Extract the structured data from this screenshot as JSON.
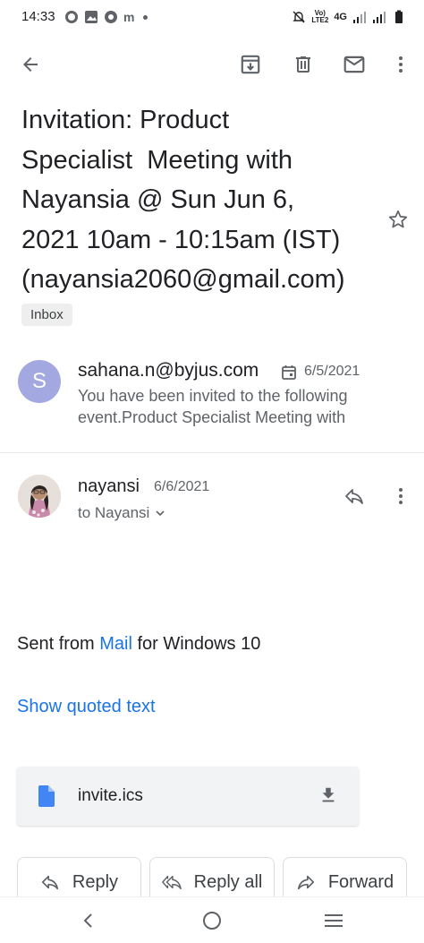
{
  "status_bar": {
    "time": "14:33",
    "left_icons": [
      "whatsapp-icon",
      "gallery-icon",
      "chrome-icon",
      "messenger-icon",
      "dot-icon"
    ],
    "network_label_top": "Vo)",
    "network_label_bottom": "LTE2",
    "network_type": "4G",
    "right_icons": [
      "mute-icon",
      "signal-icon",
      "signal-icon",
      "battery-icon"
    ]
  },
  "toolbar": {
    "icons": [
      "back-arrow-icon",
      "archive-icon",
      "delete-icon",
      "mark-unread-icon",
      "more-vert-icon"
    ]
  },
  "email": {
    "subject": "Invitation: Product\nSpecialist  Meeting with\nNayansia @ Sun Jun 6,\n2021 10am - 10:15am (IST)\n(nayansia2060@gmail.com)",
    "label": "Inbox"
  },
  "collapsed_message": {
    "avatar_letter": "S",
    "sender": "sahana.n@byjus.com",
    "date": "6/5/2021",
    "snippet": "You have been invited to the following event.Product Specialist Meeting with"
  },
  "expanded_message": {
    "sender": "nayansi",
    "date": "6/6/2021",
    "to_line": "to Nayansi",
    "body_prefix": "Sent from ",
    "body_link": "Mail",
    "body_suffix": " for Windows 10",
    "show_quoted": "Show quoted text",
    "attachment_name": "invite.ics"
  },
  "actions": {
    "reply": "Reply",
    "reply_all": "Reply all",
    "forward": "Forward"
  },
  "colors": {
    "accent": "#1a73e8",
    "avatar": "#a3a9e0",
    "file_icon": "#4285f4",
    "chip": "#eeeeee"
  }
}
